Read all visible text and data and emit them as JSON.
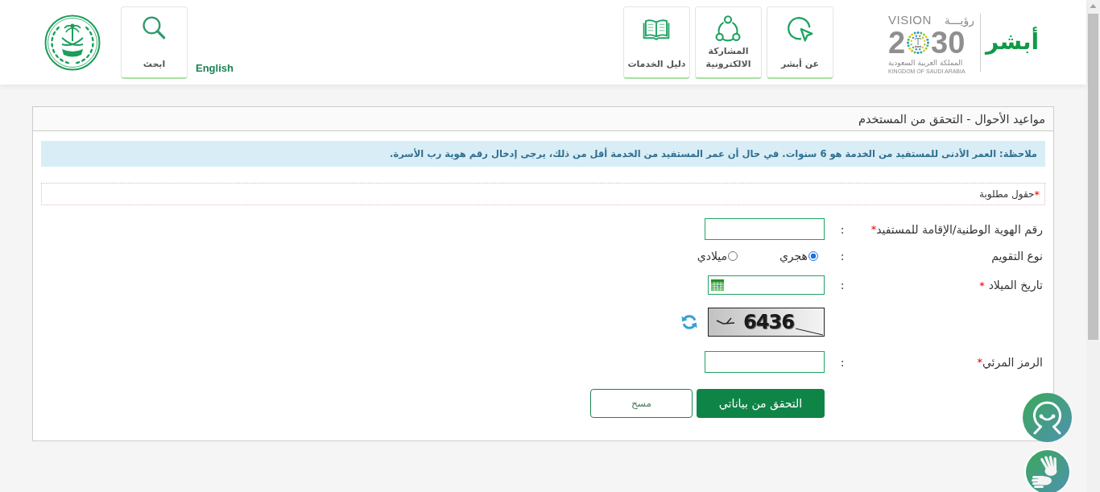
{
  "header": {
    "brand": {
      "logo_text": "أبشر",
      "vision_ar": "رؤيـــة",
      "vision_en": "VISION",
      "year_start": "2",
      "year_end": "30",
      "country_ar": "المملكة العربية السعودية",
      "country_en": "KINGDOM OF SAUDI ARABIA"
    },
    "nav": [
      {
        "kind": "cursor",
        "label": "عن أبشر"
      },
      {
        "kind": "network",
        "label": "المشاركة الالكترونية"
      },
      {
        "kind": "book",
        "label": "دليل الخدمات"
      }
    ],
    "language_link": "English",
    "search": {
      "label": "ابحث"
    }
  },
  "panel": {
    "title": "مواعيد الأحوال - التحقق من المستخدم",
    "notice": "ملاحظة: العمر الأدنى للمستفيد من الخدمة هو 6 سنوات. في حال أن عمر المستفيد من الخدمة أقل من ذلك، يرجى إدخال رقم هوية رب الأسرة.",
    "required_note": {
      "mark": "*",
      "text": "حقول مطلوبة"
    },
    "fields": [
      {
        "kind": "text",
        "label": "رقم الهوية الوطنية/الإقامة للمستفيد",
        "required_mark": "*",
        "separator": ":"
      },
      {
        "kind": "radio",
        "label": "نوع التقويم",
        "separator": ":",
        "options": [
          {
            "label": "هجري",
            "selected": true
          },
          {
            "label": "ميلادي",
            "selected": false
          }
        ]
      },
      {
        "kind": "date",
        "label": "تاريخ الميلاد",
        "required_mark": "*",
        "separator": ":"
      },
      {
        "kind": "captcha",
        "code": "6436"
      },
      {
        "kind": "text",
        "label": "الرمز المرئي",
        "required_mark": "*",
        "separator": ":"
      }
    ],
    "buttons": [
      {
        "kind": "primary",
        "label": "التحقق من بياناتي"
      },
      {
        "kind": "secondary",
        "label": "مسح"
      }
    ]
  }
}
